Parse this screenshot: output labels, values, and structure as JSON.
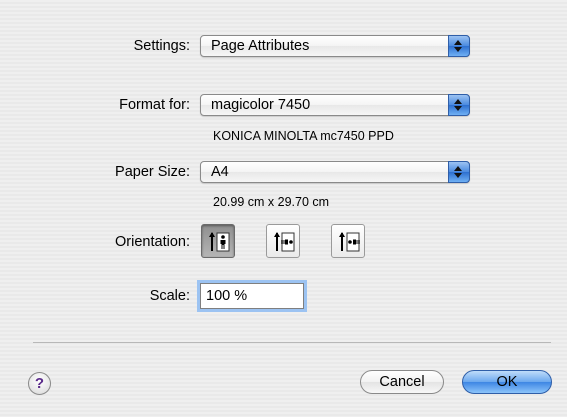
{
  "settings": {
    "label": "Settings:",
    "value": "Page Attributes"
  },
  "format_for": {
    "label": "Format for:",
    "value": "magicolor 7450",
    "detail": "KONICA MINOLTA mc7450 PPD"
  },
  "paper_size": {
    "label": "Paper Size:",
    "value": "A4",
    "detail": "20.99 cm x 29.70 cm"
  },
  "orientation": {
    "label": "Orientation:",
    "options": [
      "portrait",
      "landscape-left",
      "landscape-right"
    ],
    "selected": "portrait"
  },
  "scale": {
    "label": "Scale:",
    "value": "100 %"
  },
  "buttons": {
    "help": "?",
    "cancel": "Cancel",
    "ok": "OK"
  },
  "colors": {
    "accent": "#3e86e4",
    "focus_ring": "#9cc3f2"
  }
}
